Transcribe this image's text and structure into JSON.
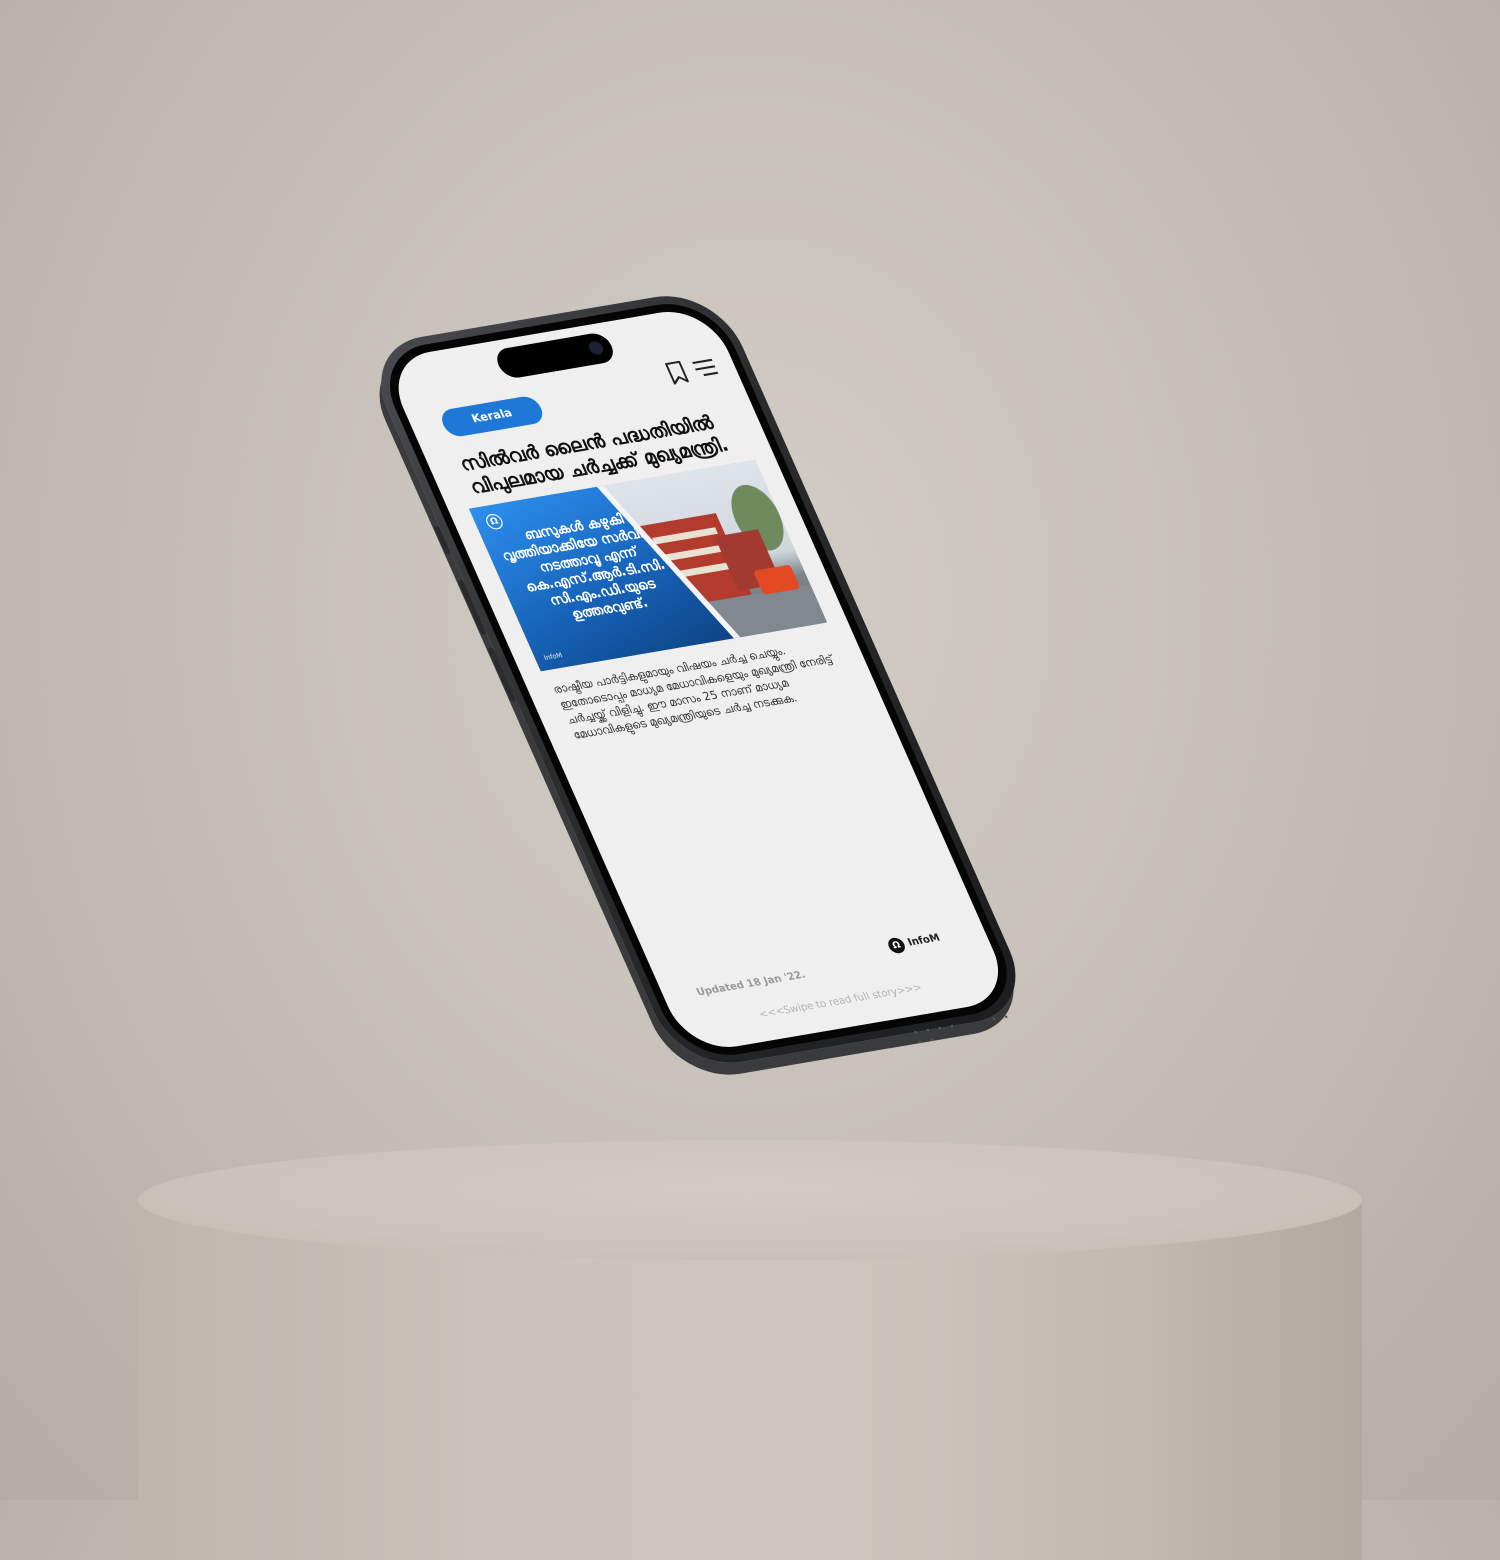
{
  "screen": {
    "category_chip": "Kerala",
    "headline": "സിൽവർ ലൈൻ പദ്ധതിയിൽ വിപുലമായ ചർച്ചക്ക് മുഖ്യമന്ത്രി.",
    "image": {
      "overlay_text": "ബസുകൾ കഴുകി വൃത്തിയാക്കിയേ സർവീസ് നടത്താവൂ എന്ന് കെ.എസ്.ആർ.ടി.സി. സി.എം.ഡി.യുടെ ഉത്തരവുണ്ട്.",
      "watermark": "InfoM"
    },
    "body": "രാഷ്ട്രീയ പാർട്ടികളുമായും വിഷയം ചർച്ച ചെയ്യും. ഇതോടൊപ്പം മാധ്യമ മേധാവികളെയും മുഖ്യമന്ത്രി നേരിട്ട് ചർച്ചയ്ക്ക് വിളിച്ചു. ഈ മാസം 25 നാണ് മാധ്യമ മേധാവികളുടെ മുഖ്യമന്ത്രിയുടെ ചർച്ച നടക്കുക.",
    "brand": "InfoM",
    "updated": "Updated 18 Jan '22.",
    "swipe_hint": "<<<Swipe to read full story>>>"
  },
  "icons": {
    "bookmark": "bookmark-icon",
    "menu": "menu-icon",
    "brand_logo": "infom-logo-icon"
  },
  "colors": {
    "accent": "#1e78d7",
    "screen_bg": "#efefef",
    "backdrop": "#c3bdb5"
  }
}
